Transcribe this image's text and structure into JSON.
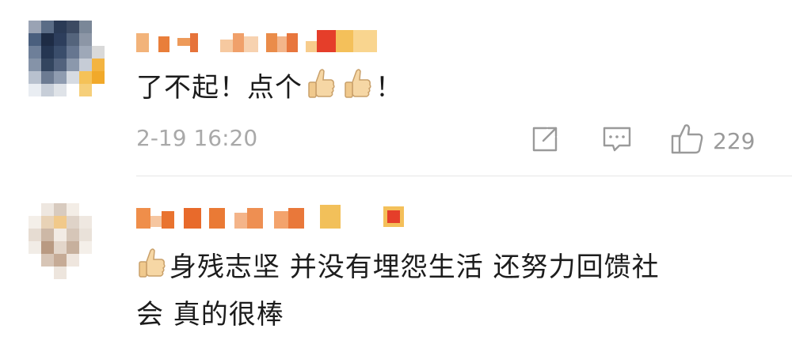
{
  "comments": [
    {
      "text_before": "了不起！点个",
      "text_after": "！",
      "time": "2-19 16:20",
      "like_count": "229",
      "icons": {
        "share": "share-icon",
        "reply": "comment-icon",
        "like": "thumbs-up-outline-icon",
        "emoji": "thumbs-up-emoji-icon"
      }
    },
    {
      "text_lines": [
        "身残志坚 并没有埋怨生活 还努力回馈社",
        "会 真的很棒"
      ],
      "icons": {
        "emoji": "thumbs-up-emoji-icon"
      }
    }
  ],
  "colors": {
    "accent_orange": "#ef8a3a",
    "accent_red": "#e53e2a",
    "meta_gray": "#a9a9a9",
    "divider": "#e6e6e6"
  }
}
